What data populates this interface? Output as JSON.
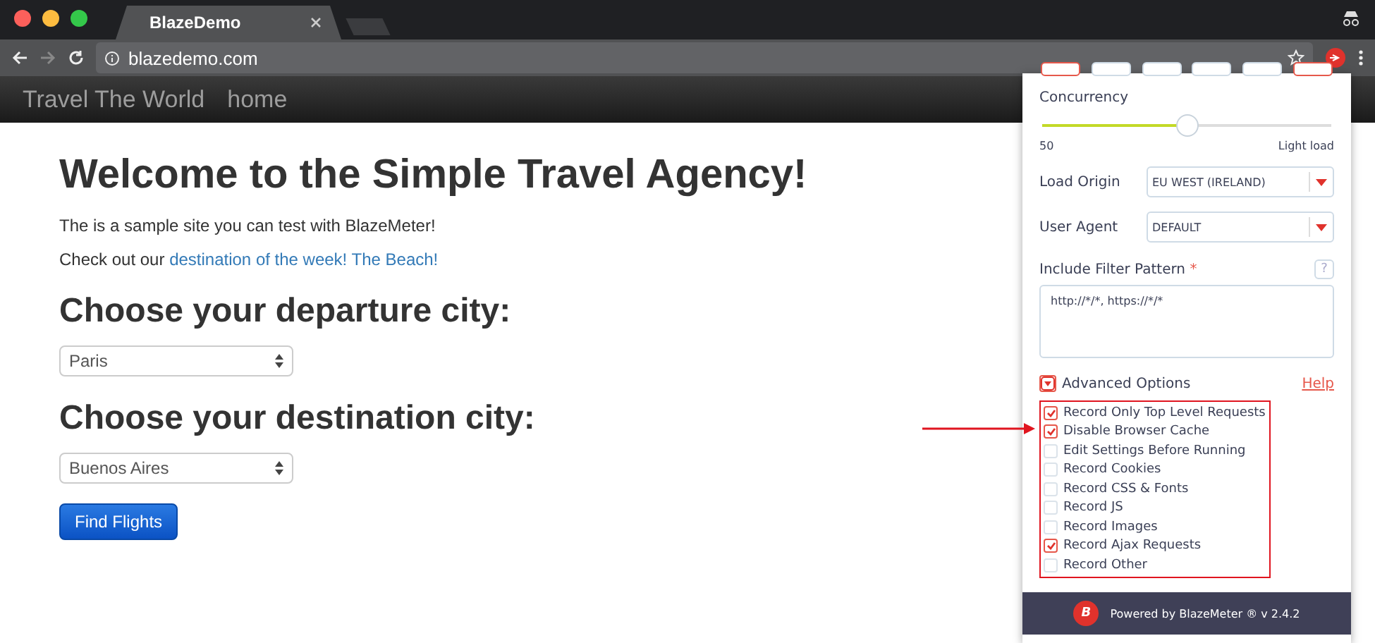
{
  "browser": {
    "tab_title": "BlazeDemo",
    "address": "blazedemo.com"
  },
  "navbar": {
    "brand": "Travel The World",
    "links": [
      "home"
    ]
  },
  "page": {
    "heading": "Welcome to the Simple Travel Agency!",
    "intro": "The is a sample site you can test with BlazeMeter!",
    "promo_text": "Check out our",
    "promo_link": "destination of the week! The Beach!",
    "sections": [
      {
        "heading": "Choose your departure city:",
        "value": "Paris"
      },
      {
        "heading": "Choose your destination city:",
        "value": "Buenos Aires"
      }
    ],
    "button": "Find Flights"
  },
  "popup": {
    "top_buttons": [
      {
        "selected": true
      },
      {
        "selected": false
      },
      {
        "selected": false
      },
      {
        "selected": false
      },
      {
        "selected": false
      },
      {
        "selected": true
      }
    ],
    "concurrency": {
      "label": "Concurrency",
      "level": 0.5,
      "value": "50",
      "hint": "Light load"
    },
    "dropdowns": [
      {
        "label": "Load Origin",
        "value": "EU WEST (IRELAND)"
      },
      {
        "label": "User Agent",
        "value": "DEFAULT"
      }
    ],
    "filter": {
      "label": "Include Filter Pattern",
      "required_mark": "*",
      "help": "?",
      "value": "http://*/*, https://*/*"
    },
    "advanced": {
      "label": "Advanced Options",
      "help_link": "Help"
    },
    "options": [
      {
        "label": "Record Only Top Level Requests",
        "checked": true
      },
      {
        "label": "Disable Browser Cache",
        "checked": true
      },
      {
        "label": "Edit Settings Before Running",
        "checked": false
      },
      {
        "label": "Record Cookies",
        "checked": false
      },
      {
        "label": "Record CSS & Fonts",
        "checked": false
      },
      {
        "label": "Record JS",
        "checked": false
      },
      {
        "label": "Record Images",
        "checked": false
      },
      {
        "label": "Record Ajax Requests",
        "checked": true
      },
      {
        "label": "Record Other",
        "checked": false
      }
    ],
    "footer": {
      "logo": "B",
      "text": "Powered by BlazeMeter ® v 2.4.2"
    }
  }
}
